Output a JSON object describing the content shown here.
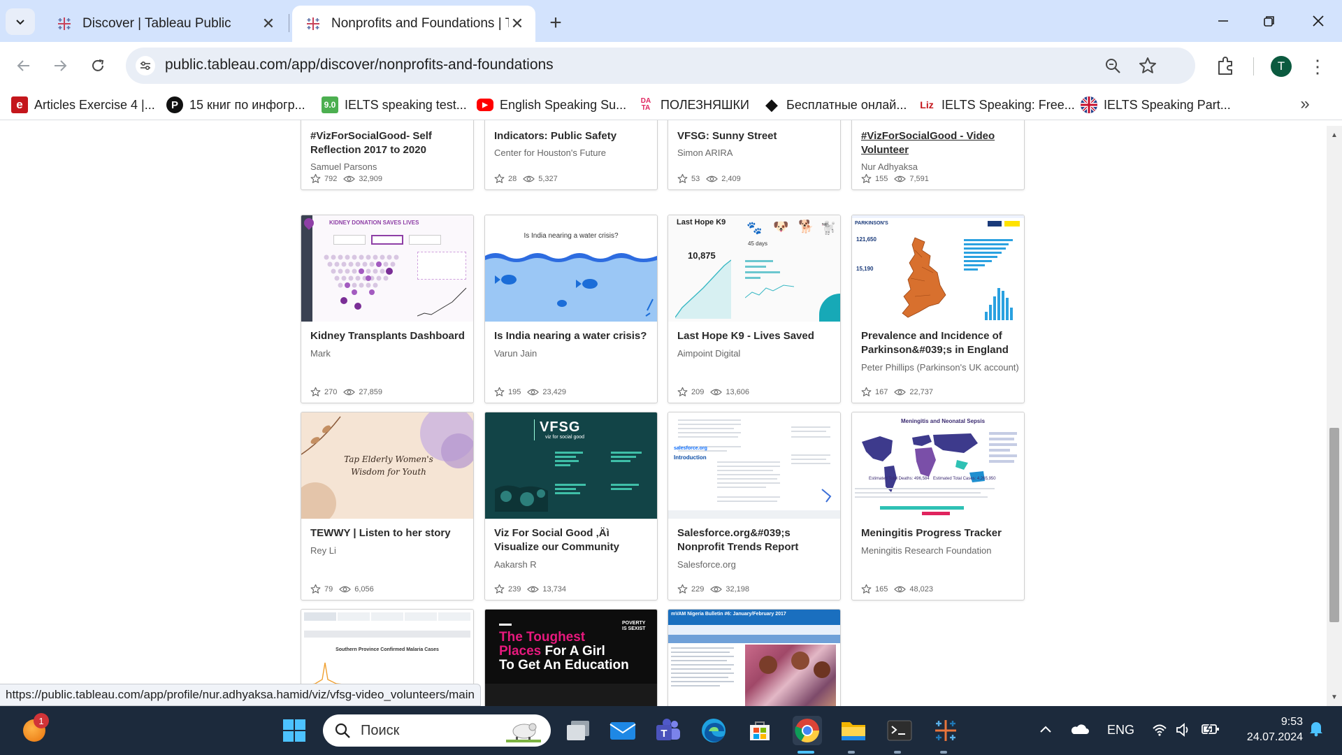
{
  "browser": {
    "tabs": [
      {
        "title": "Discover | Tableau Public",
        "active": false
      },
      {
        "title": "Nonprofits and Foundations | Ta",
        "active": true
      }
    ],
    "new_tab_symbol": "+",
    "url": "public.tableau.com/app/discover/nonprofits-and-foundations",
    "avatar_letter": "T",
    "bookmarks": [
      {
        "label": "Articles Exercise 4 |...",
        "icon": "e",
        "color": "#c4161c"
      },
      {
        "label": "15 книг по инфогр...",
        "icon": "P",
        "color": "#111111"
      },
      {
        "label": "IELTS speaking test...",
        "icon": "9.0",
        "color": "#4caf50"
      },
      {
        "label": "English Speaking Su...",
        "icon": "▶",
        "color": "#ff0000"
      },
      {
        "label": "ПОЛЕЗНЯШКИ",
        "icon": "DA TA",
        "color": "#e0245e"
      },
      {
        "label": "Бесплатные онлай...",
        "icon": "◆",
        "color": "#111111"
      },
      {
        "label": "IELTS Speaking: Free...",
        "icon": "Liz",
        "color": "#c4161c"
      },
      {
        "label": "IELTS Speaking Part...",
        "icon": "UK",
        "color": "#1f3c88"
      }
    ],
    "status_url": "https://public.tableau.com/app/profile/nur.adhyaksa.hamid/viz/vfsg-video_volunteers/main"
  },
  "cards_row1": [
    {
      "title": "#VizForSocialGood- Self Reflection 2017 to 2020",
      "author": "Samuel Parsons",
      "favorites": "792",
      "views": "32,909"
    },
    {
      "title": "Indicators: Public Safety",
      "author": "Center for Houston's Future",
      "favorites": "28",
      "views": "5,327"
    },
    {
      "title": "VFSG: Sunny Street",
      "author": "Simon ARIRA",
      "favorites": "53",
      "views": "2,409"
    },
    {
      "title": "#VizForSocialGood - Video Volunteer",
      "author": "Nur Adhyaksa",
      "favorites": "155",
      "views": "7,591"
    }
  ],
  "cards_row2": [
    {
      "title": "Kidney Transplants Dashboard",
      "author": "Mark",
      "favorites": "270",
      "views": "27,859",
      "thumb_text": "KIDNEY DONATION SAVES LIVES"
    },
    {
      "title": "Is India nearing a water crisis?",
      "author": "Varun Jain",
      "favorites": "195",
      "views": "23,429",
      "thumb_text": "Is India nearing a water crisis?"
    },
    {
      "title": "Last Hope K9 - Lives Saved",
      "author": "Aimpoint Digital",
      "favorites": "209",
      "views": "13,606",
      "thumb_text": "Last Hope K9",
      "thumb_num": "10,875"
    },
    {
      "title": "Prevalence and Incidence of Parkinson&#039;s in England",
      "author": "Peter Phillips (Parkinson's UK account)",
      "favorites": "167",
      "views": "22,737",
      "thumb_text": "PARKINSON'S"
    }
  ],
  "cards_row3": [
    {
      "title": "TEWWY | Listen to her story",
      "author": "Rey Li",
      "favorites": "79",
      "views": "6,056",
      "thumb_text": "Tap Elderly Women's Wisdom for Youth"
    },
    {
      "title": "Viz For Social Good ‚Äì Visualize our Community",
      "author": "Aakarsh R",
      "favorites": "239",
      "views": "13,734",
      "thumb_text": "viz for social good"
    },
    {
      "title": "Salesforce.org&#039;s Nonprofit Trends Report",
      "author": "Salesforce.org",
      "favorites": "229",
      "views": "32,198",
      "thumb_text": "Introduction"
    },
    {
      "title": "Meningitis Progress Tracker",
      "author": "Meningitis Research Foundation",
      "favorites": "165",
      "views": "48,023",
      "thumb_text": "Meningitis and Neonatal Sepsis"
    }
  ],
  "cards_row4": [
    {
      "thumb_text": "Southern Province Confirmed Malaria Cases"
    },
    {
      "thumb_text_1": "The Toughest",
      "thumb_text_2": "Places",
      "thumb_text_3": "For A Girl",
      "thumb_text_4": "To Get An Education"
    },
    {
      "thumb_text": "mVAM Nigeria Bulletin #6: January/February 2017"
    }
  ],
  "taskbar": {
    "search_placeholder": "Поиск",
    "notification_count": "1",
    "language": "ENG",
    "time": "9:53",
    "date": "24.07.2024"
  }
}
